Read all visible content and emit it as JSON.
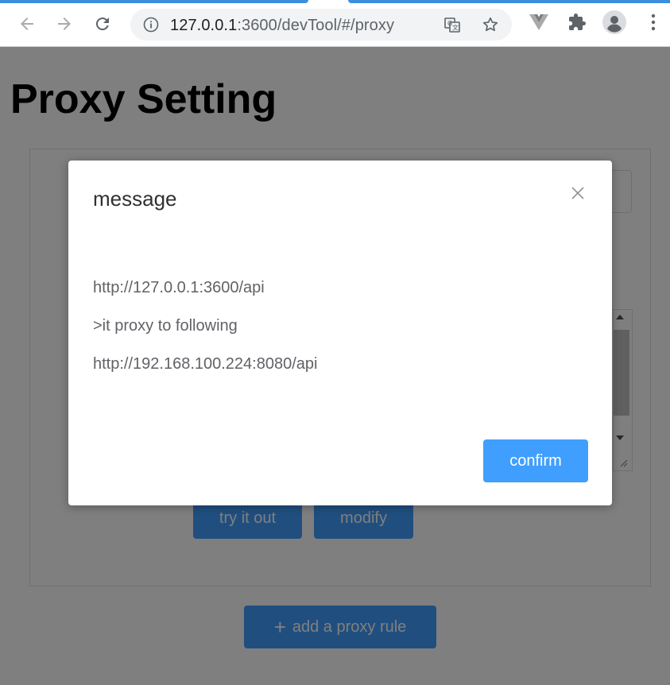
{
  "browser": {
    "url_host": "127.0.0.1",
    "url_path": ":3600/devTool/#/proxy",
    "icons": [
      "back-icon",
      "forward-icon",
      "reload-icon",
      "site-info-icon",
      "translate-icon",
      "bookmark-star-icon",
      "vue-devtools-icon",
      "extensions-icon",
      "profile-icon",
      "menu-icon"
    ]
  },
  "page": {
    "title": "Proxy Setting",
    "buttons": {
      "try_label": "try it out",
      "modify_label": "modify",
      "add_label": "add a proxy rule",
      "add_icon": "+"
    }
  },
  "dialog": {
    "title": "message",
    "lines": [
      "http://127.0.0.1:3600/api",
      ">it proxy to following",
      "http://192.168.100.224:8080/api"
    ],
    "confirm_label": "confirm"
  },
  "colors": {
    "primary": "#409eff",
    "overlay": "rgba(0,0,0,0.5)",
    "tab_accent": "#3e8ede"
  }
}
